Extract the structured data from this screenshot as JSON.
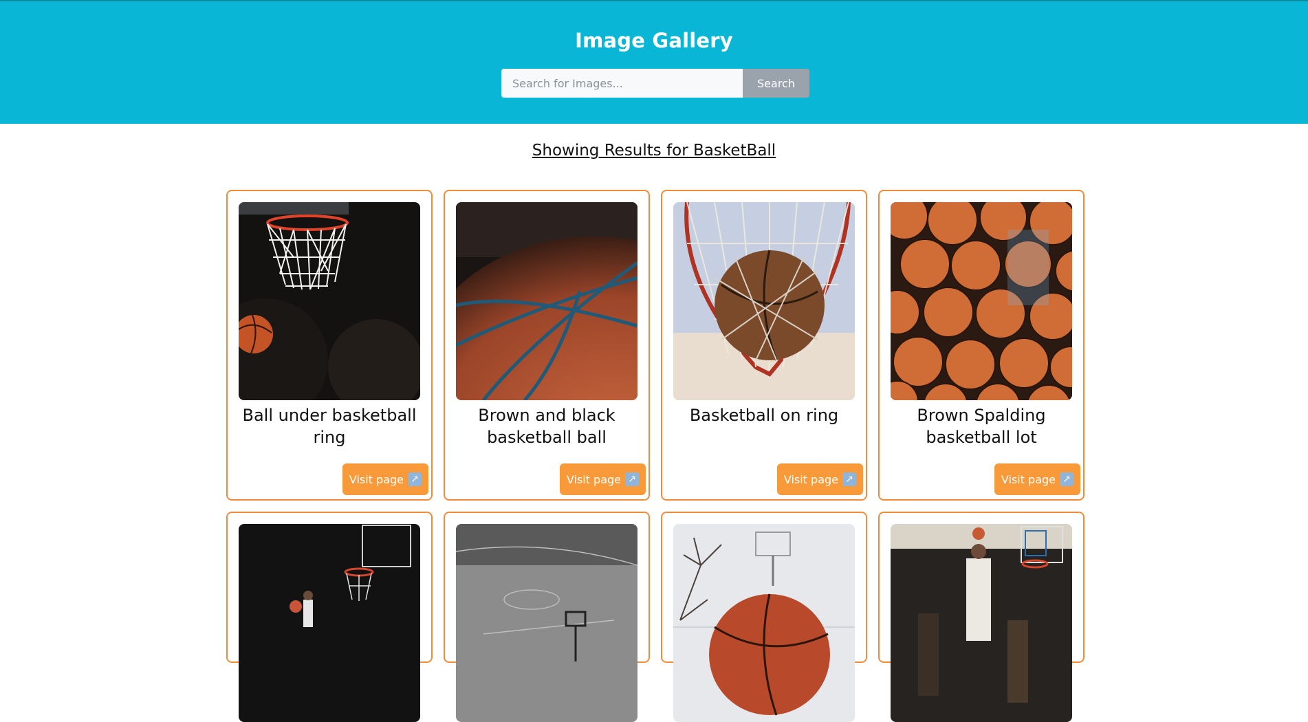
{
  "header": {
    "title": "Image Gallery",
    "search": {
      "placeholder": "Search for Images...",
      "value": "",
      "button_label": "Search"
    }
  },
  "results": {
    "title": "Showing Results for BasketBall"
  },
  "cards": [
    {
      "caption": "Ball under basketball ring",
      "button_label": "Visit page",
      "icon": "external-link-icon"
    },
    {
      "caption": "Brown and black basketball ball",
      "button_label": "Visit page",
      "icon": "external-link-icon"
    },
    {
      "caption": "Basketball on ring",
      "button_label": "Visit page",
      "icon": "external-link-icon"
    },
    {
      "caption": "Brown Spalding basketball lot",
      "button_label": "Visit page",
      "icon": "external-link-icon"
    },
    {
      "caption": "",
      "button_label": "",
      "icon": ""
    },
    {
      "caption": "",
      "button_label": "",
      "icon": ""
    },
    {
      "caption": "",
      "button_label": "",
      "icon": ""
    },
    {
      "caption": "",
      "button_label": "",
      "icon": ""
    }
  ],
  "colors": {
    "header_bg": "#0ab6d6",
    "card_border": "#f28c38",
    "button_bg": "#f89a3a",
    "search_button_bg": "#9aa3ab"
  }
}
